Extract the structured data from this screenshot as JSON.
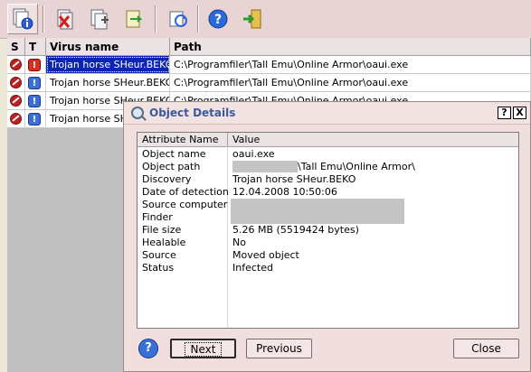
{
  "toolbar": {
    "buttons": [
      "details-icon",
      "delete-icon",
      "copy-add-icon",
      "export-icon",
      "refresh-icon",
      "help-icon",
      "exit-icon"
    ]
  },
  "list": {
    "headers": {
      "s": "S",
      "t": "T",
      "name": "Virus name",
      "path": "Path"
    },
    "rows": [
      {
        "name": "Trojan horse SHeur.BEKO",
        "path": "C:\\Programfiler\\Tall Emu\\Online Armor\\oaui.exe",
        "type": "red"
      },
      {
        "name": "Trojan horse SHeur.BEKO",
        "path": "C:\\Programfiler\\Tall Emu\\Online Armor\\oaui.exe",
        "type": "blue"
      },
      {
        "name": "Trojan horse SHeur.BEKO",
        "path": "C:\\Programfiler\\Tall Emu\\Online Armor\\oaui.exe",
        "type": "blue"
      },
      {
        "name": "Trojan horse SHeur.BEKO",
        "path": "",
        "type": "blue"
      }
    ],
    "icon_t_red": "!",
    "icon_t_blue": "!"
  },
  "dialog": {
    "title": "Object Details",
    "help_cap": "?",
    "close_cap": "X",
    "col_attr": "Attribute Name",
    "col_value": "Value",
    "attributes": [
      {
        "name": "Object name",
        "value": "oaui.exe"
      },
      {
        "name": "Object path",
        "value": "\\Tall Emu\\Online Armor\\"
      },
      {
        "name": "Discovery",
        "value": "Trojan horse SHeur.BEKO"
      },
      {
        "name": "Date of detection",
        "value": "12.04.2008 10:50:06"
      },
      {
        "name": "Source computer",
        "value": ""
      },
      {
        "name": "Finder",
        "value": ""
      },
      {
        "name": "File size",
        "value": "5.26 MB (5519424 bytes)"
      },
      {
        "name": "Healable",
        "value": "No"
      },
      {
        "name": "Source",
        "value": "Moved object"
      },
      {
        "name": "Status",
        "value": "Infected"
      }
    ],
    "help_button": "?",
    "next_button": "Next",
    "previous_button": "Previous",
    "close_button": "Close"
  }
}
